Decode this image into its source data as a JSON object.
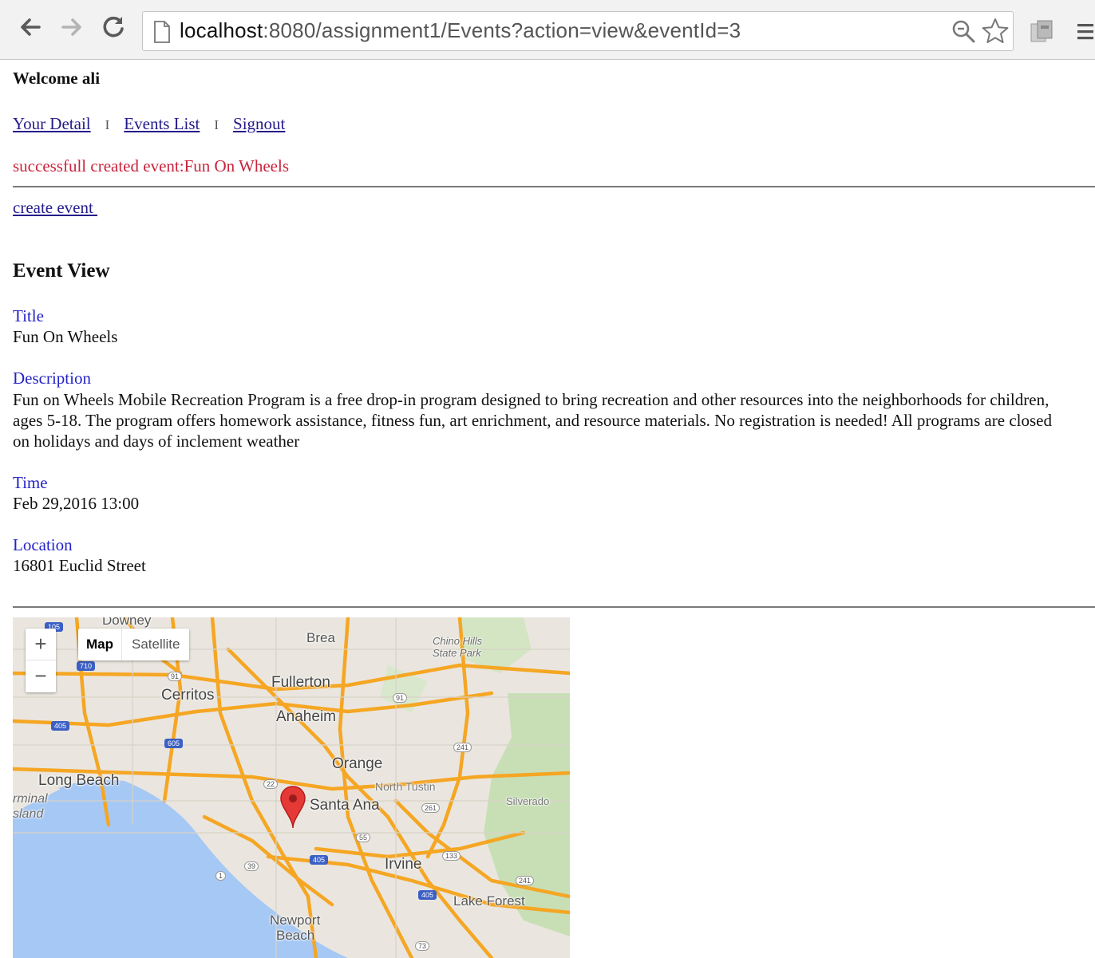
{
  "browser": {
    "url_host": "localhost",
    "url_rest": ":8080/assignment1/Events?action=view&eventId=3",
    "icons": [
      "back-icon",
      "forward-icon",
      "reload-icon",
      "page-icon",
      "zoom-icon",
      "star-icon",
      "extension-icon",
      "menu-icon"
    ]
  },
  "page": {
    "welcome": "Welcome ali",
    "nav": {
      "your_detail": "Your Detail",
      "separator": "I",
      "events_list": "Events List",
      "signout": "Signout"
    },
    "message": "successfull created event:Fun On Wheels",
    "create_event": "create event ",
    "heading": "Event View",
    "fields": {
      "title_label": "Title",
      "title_value": "Fun On Wheels",
      "description_label": "Description",
      "description_value": "Fun on Wheels Mobile Recreation Program is a free drop-in program designed to bring recreation and other resources into the neighborhoods for children, ages 5-18. The program offers homework assistance, fitness fun, art enrichment, and resource materials. No registration is needed! All programs are closed on holidays and days of inclement weather",
      "time_label": "Time",
      "time_value": "Feb 29,2016 13:00",
      "location_label": "Location",
      "location_value": "16801 Euclid Street"
    }
  },
  "map": {
    "zoom_in": "+",
    "zoom_out": "−",
    "type_map": "Map",
    "type_satellite": "Satellite",
    "places": {
      "brea": "Brea",
      "chino_1": "Chino Hills",
      "chino_2": "State Park",
      "fullerton": "Fullerton",
      "cerritos": "Cerritos",
      "anaheim": "Anaheim",
      "orange": "Orange",
      "long_beach": "Long Beach",
      "terminal_1": "rminal",
      "terminal_2": "sland",
      "north_tustin": "North Tustin",
      "santa_ana": "Santa Ana",
      "silverado": "Silverado",
      "irvine": "Irvine",
      "lake_forest": "Lake Forest",
      "newport_1": "Newport",
      "newport_2": "Beach",
      "downey": "Downey"
    },
    "shields": {
      "i105": "105",
      "i710": "710",
      "i405a": "405",
      "i605": "605",
      "r91a": "91",
      "r91b": "91",
      "r22": "22",
      "r241a": "241",
      "r261": "261",
      "r55": "55",
      "r133": "133",
      "r39": "39",
      "r1": "1",
      "i405b": "405",
      "i405c": "405",
      "r241b": "241",
      "r73": "73"
    },
    "colors": {
      "water": "#a6c8f5",
      "land": "#eae6df",
      "park": "#c8dfb6",
      "highway": "#f5a623",
      "pin": "#e53935"
    }
  }
}
